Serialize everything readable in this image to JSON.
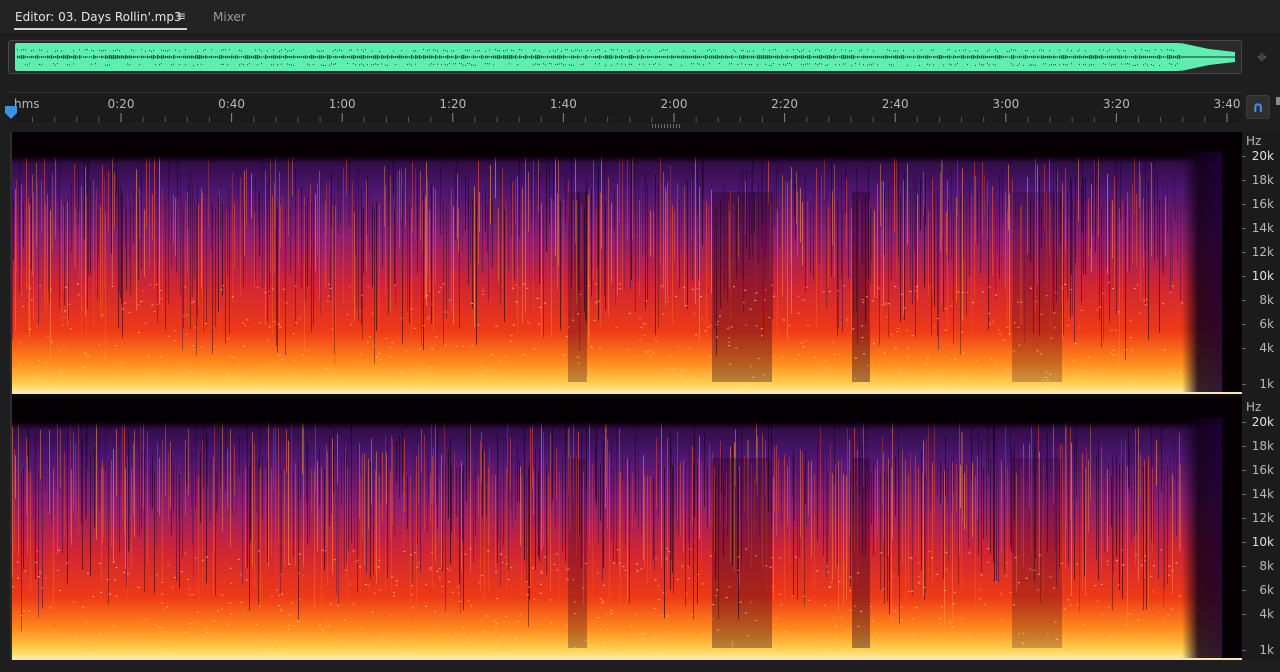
{
  "tabs": {
    "editor_label": "Editor: 03. Days Rollin'.mp3",
    "menu_icon": "hamburger-menu-icon",
    "mixer_label": "Mixer"
  },
  "colors": {
    "overview_waveform": "#5cefb0",
    "accent": "#3d8fe8",
    "spectral_low": "#1a0020",
    "spectral_mid": "#d42a1c",
    "spectral_high": "#ffd45a"
  },
  "ruler": {
    "unit": "hms",
    "labels": [
      "0:20",
      "0:40",
      "1:00",
      "1:20",
      "1:40",
      "2:00",
      "2:20",
      "2:40",
      "3:00",
      "3:20",
      "3:40"
    ]
  },
  "hz_axis": {
    "unit": "Hz",
    "labels": [
      "20k",
      "18k",
      "16k",
      "14k",
      "12k",
      "10k",
      "8k",
      "6k",
      "4k",
      "1k"
    ]
  },
  "icons": {
    "zoom_navigator": "zoom-navigator-icon",
    "snap": "snap-magnet-icon",
    "playhead": "playhead-marker-icon"
  }
}
